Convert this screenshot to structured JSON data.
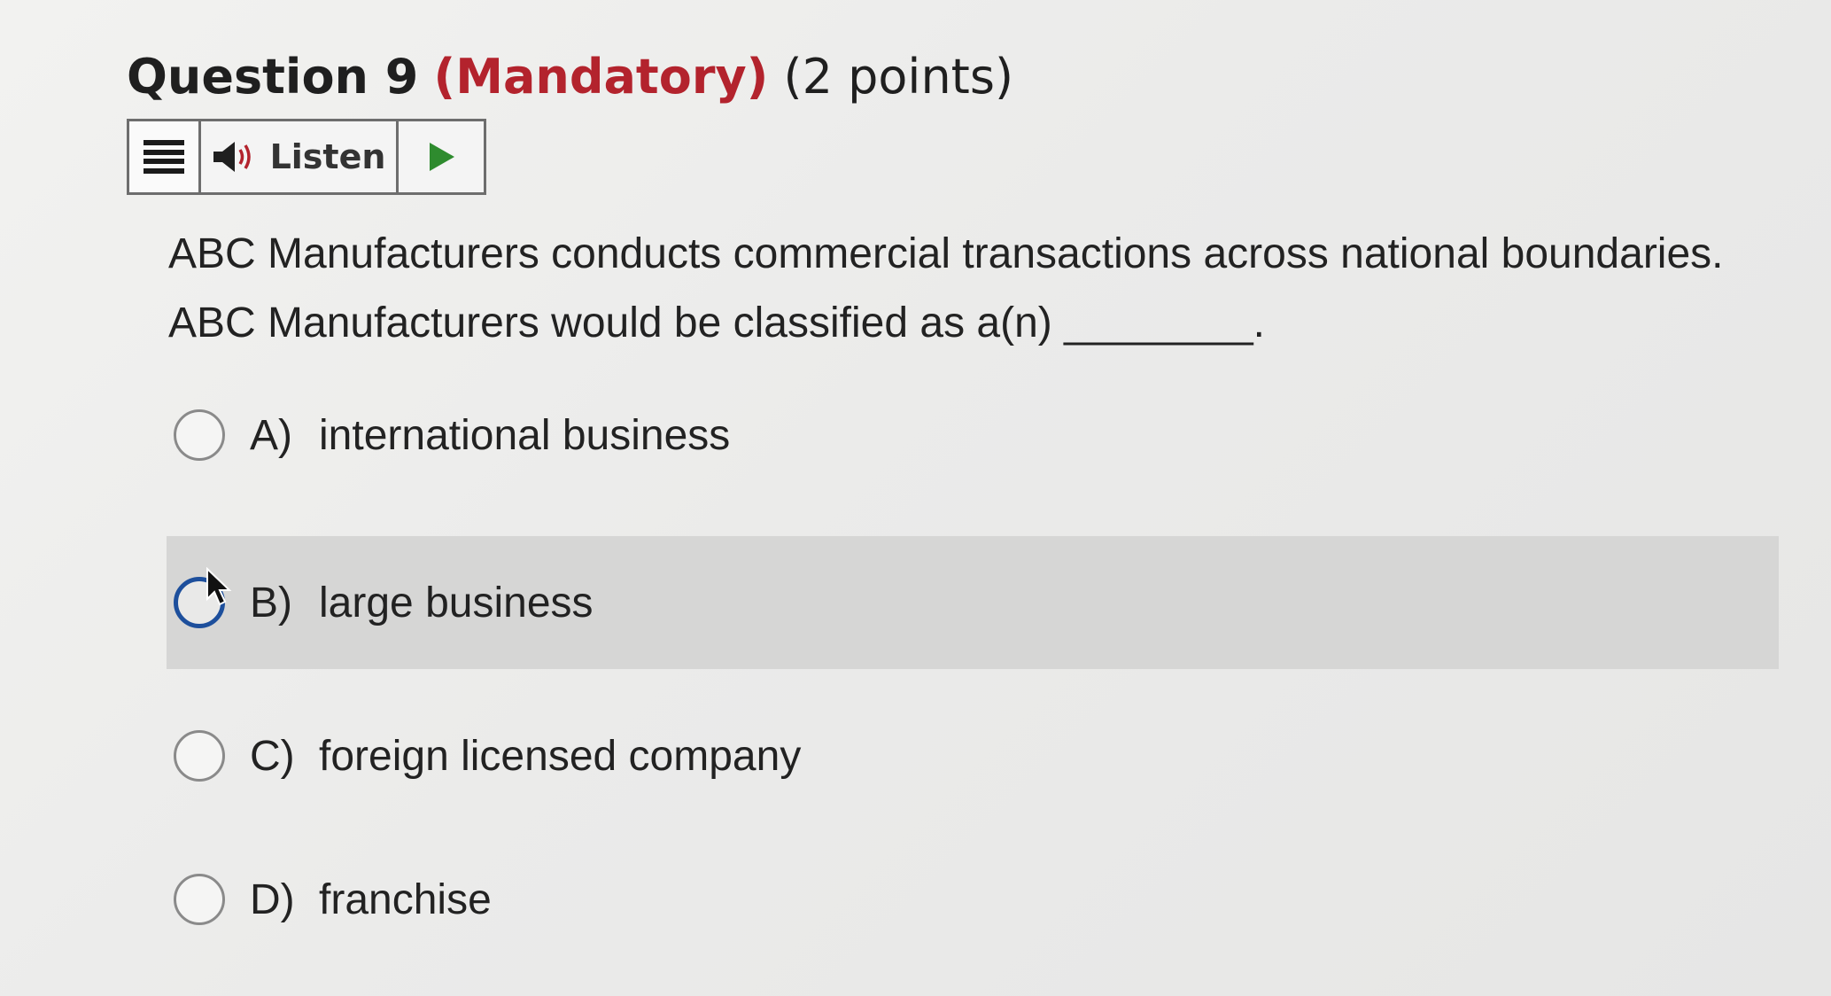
{
  "question": {
    "number_label": "Question 9",
    "mandatory_label": "(Mandatory)",
    "points_label": "(2 points)",
    "text_line1": "ABC Manufacturers conducts commercial transactions across national boundaries.",
    "text_line2": "ABC Manufacturers would be classified as a(n) ________."
  },
  "toolbar": {
    "menu_icon": "hamburger-menu-icon",
    "speaker_icon": "speaker-icon",
    "listen_label": "Listen",
    "play_icon": "play-icon",
    "play_color": "#2e8b2e"
  },
  "options": [
    {
      "letter": "A)",
      "text": "international business"
    },
    {
      "letter": "B)",
      "text": "large business"
    },
    {
      "letter": "C)",
      "text": "foreign licensed company"
    },
    {
      "letter": "D)",
      "text": "franchise"
    }
  ],
  "colors": {
    "mandatory": "#b3232d",
    "focus_ring": "#1d4f9c",
    "highlight_row": "#d6d6d5"
  }
}
